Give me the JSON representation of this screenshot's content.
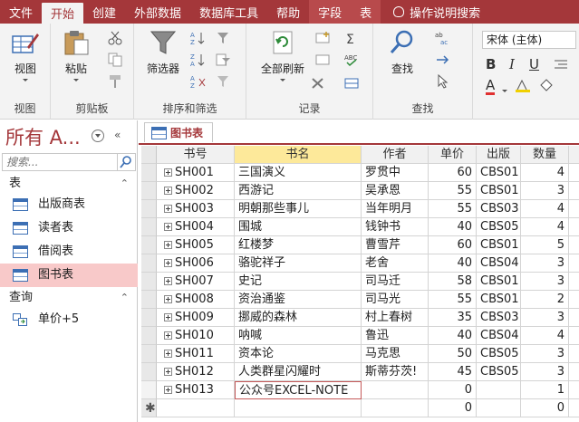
{
  "tabs": [
    {
      "label": "文件"
    },
    {
      "label": "开始"
    },
    {
      "label": "创建"
    },
    {
      "label": "外部数据"
    },
    {
      "label": "数据库工具"
    },
    {
      "label": "帮助"
    },
    {
      "label": "字段"
    },
    {
      "label": "表"
    },
    {
      "label": "操作说明搜索"
    }
  ],
  "ribbon": {
    "view": {
      "label": "视图",
      "group": "视图"
    },
    "clipboard": {
      "paste": "粘贴",
      "group": "剪贴板"
    },
    "sort": {
      "filter": "筛选器",
      "group": "排序和筛选"
    },
    "records": {
      "refresh": "全部刷新",
      "group": "记录"
    },
    "find": {
      "find": "查找",
      "group": "查找"
    },
    "text": {
      "font": "宋体 (主体)",
      "bold": "B",
      "italic": "I",
      "underline": "U",
      "fontcolor": "A"
    }
  },
  "nav": {
    "title": "所有 A...",
    "search_placeholder": "搜索...",
    "cat_tables": "表",
    "cat_queries": "查询",
    "tables": [
      "出版商表",
      "读者表",
      "借阅表",
      "图书表"
    ],
    "queries": [
      "单价+5"
    ],
    "collapse": "«"
  },
  "doc": {
    "tab": "图书表",
    "columns": [
      "书号",
      "书名",
      "作者",
      "单价",
      "出版",
      "数量"
    ],
    "rows": [
      [
        "SH001",
        "三国演义",
        "罗贯中",
        "60",
        "CBS01",
        "4"
      ],
      [
        "SH002",
        "西游记",
        "吴承恩",
        "55",
        "CBS01",
        "3"
      ],
      [
        "SH003",
        "明朝那些事儿",
        "当年明月",
        "55",
        "CBS03",
        "4"
      ],
      [
        "SH004",
        "围城",
        "钱钟书",
        "40",
        "CBS05",
        "4"
      ],
      [
        "SH005",
        "红楼梦",
        "曹雪芹",
        "60",
        "CBS01",
        "5"
      ],
      [
        "SH006",
        "骆驼祥子",
        "老舍",
        "40",
        "CBS04",
        "3"
      ],
      [
        "SH007",
        "史记",
        "司马迁",
        "58",
        "CBS01",
        "3"
      ],
      [
        "SH008",
        "资治通鉴",
        "司马光",
        "55",
        "CBS01",
        "2"
      ],
      [
        "SH009",
        "挪威的森林",
        "村上春树",
        "35",
        "CBS03",
        "3"
      ],
      [
        "SH010",
        "呐喊",
        "鲁迅",
        "40",
        "CBS04",
        "4"
      ],
      [
        "SH011",
        "资本论",
        "马克思",
        "50",
        "CBS05",
        "3"
      ],
      [
        "SH012",
        "人类群星闪耀时",
        "斯蒂芬茨!",
        "45",
        "CBS05",
        "3"
      ],
      [
        "SH013",
        "公众号EXCEL-NOTE",
        "",
        "0",
        "",
        "1"
      ]
    ],
    "new_row": {
      "price": "0",
      "qty": "0"
    }
  },
  "colors": {
    "accent": "#a4373a",
    "selected": "#f8c9c9",
    "header_sorted": "#fde99a"
  }
}
